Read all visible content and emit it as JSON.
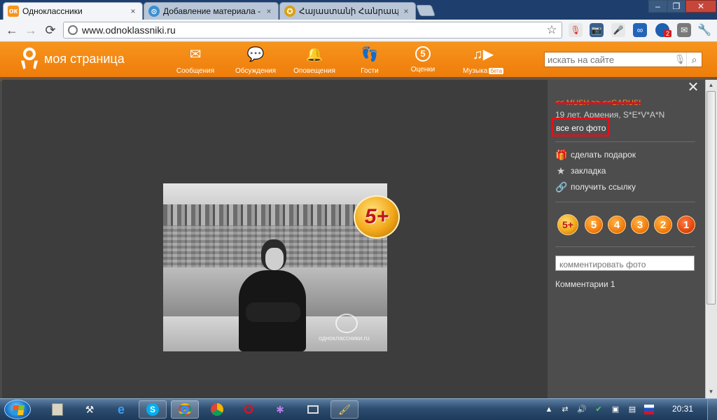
{
  "browser": {
    "tabs": [
      {
        "title": "Одноклассники",
        "favicon": "ok-favicon",
        "active": true
      },
      {
        "title": "Добавление материала - ",
        "favicon": "site-favicon",
        "active": false
      },
      {
        "title": "Հայաստանի Հանրապետւ",
        "favicon": "armenia-favicon",
        "active": false
      }
    ],
    "close_glyph": "×",
    "window_controls": {
      "minimize": "–",
      "maximize": "❐",
      "close": "✕"
    },
    "url": "www.odnoklassniki.ru",
    "back": "←",
    "forward": "→",
    "reload": "⟳",
    "star": "☆",
    "extension_badge": "2"
  },
  "site": {
    "title": "моя страница",
    "nav": [
      {
        "label": "Сообщения",
        "icon": "envelope-icon",
        "glyph": "✉"
      },
      {
        "label": "Обсуждения",
        "icon": "chat-icon",
        "glyph": "💬"
      },
      {
        "label": "Оповещения",
        "icon": "bell-icon",
        "glyph": "🔔"
      },
      {
        "label": "Гости",
        "icon": "footprints-icon",
        "glyph": "👣"
      },
      {
        "label": "Оценки",
        "icon": "rating-five-icon",
        "glyph": "5"
      },
      {
        "label": "Музыка",
        "icon": "music-icon",
        "glyph": "♫▶",
        "badge": "бета"
      }
    ],
    "search_placeholder": "искать на сайте"
  },
  "photo": {
    "watermark": "одноклассники.ru",
    "rating_badge": "5+"
  },
  "panel": {
    "close": "✕",
    "user_name": "<< MUSH >> <<GARUSI",
    "user_info": "19 лет, Армения, S*E*V*A*N",
    "all_photos": "все его фото",
    "actions": [
      {
        "label": "сделать подарок",
        "icon": "gift-icon",
        "glyph": "🎁"
      },
      {
        "label": "закладка",
        "icon": "star-icon",
        "glyph": "★"
      },
      {
        "label": "получить ссылку",
        "icon": "link-icon",
        "glyph": "🔗"
      }
    ],
    "ratings": [
      "5+",
      "5",
      "4",
      "3",
      "2",
      "1"
    ],
    "comment_placeholder": "комментировать фото",
    "comments_label": "Комментарии 1"
  },
  "taskbar": {
    "clock": "20:31"
  }
}
